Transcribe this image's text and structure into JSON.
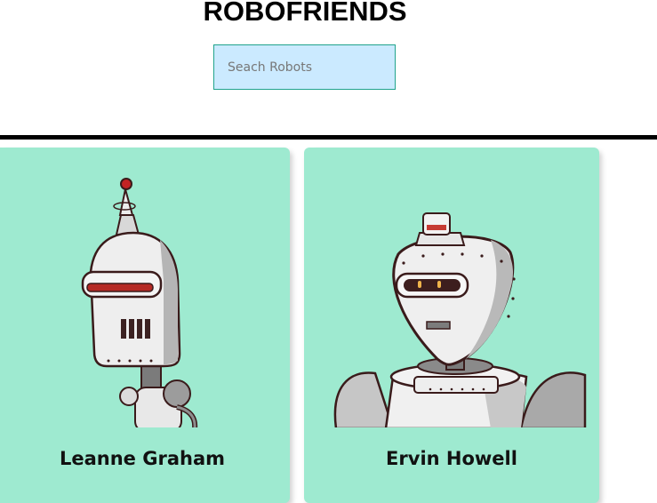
{
  "header": {
    "title": "ROBOFRIENDS"
  },
  "search": {
    "placeholder": "Seach Robots",
    "value": ""
  },
  "robots": [
    {
      "name": "Leanne Graham",
      "avatar": "robot-avatar-1"
    },
    {
      "name": "Ervin Howell",
      "avatar": "robot-avatar-2"
    }
  ],
  "colors": {
    "card_bg": "#9eead0",
    "search_bg": "#cbeaff",
    "search_border": "#20a38c",
    "divider": "#000000"
  }
}
